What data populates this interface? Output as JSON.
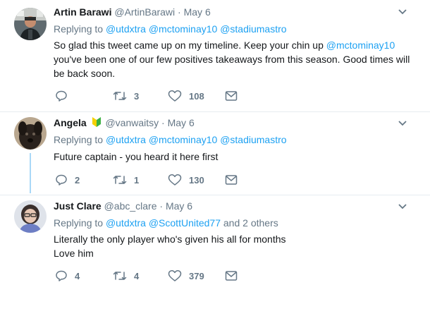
{
  "colors": {
    "link": "#1da1f2",
    "muted": "#657786",
    "text": "#14171a",
    "divider": "#e6ecf0",
    "thread": "#a9d8f7"
  },
  "tweets": [
    {
      "display_name": "Artin Barawi",
      "handle": "@ArtinBarawi",
      "date": "May 6",
      "replying_label": "Replying to",
      "replying_to": [
        "@utdxtra",
        "@mctominay10",
        "@stadiumastro"
      ],
      "text_lines": [
        [
          "So glad this tweet came up on my timeline. Keep your chin up ",
          "@mctominay10"
        ],
        [
          "you've been one of our few positives takeaways from this season. Good times will"
        ],
        [
          "be back soon."
        ]
      ],
      "reply_count": "",
      "retweet_count": "3",
      "like_count": "108",
      "icons": {
        "reply": "reply-icon",
        "retweet": "retweet-icon",
        "like": "heart-icon",
        "dm": "envelope-icon",
        "menu": "chevron-down-icon"
      }
    },
    {
      "display_name": "Angela",
      "badge_icon": "beginner-badge-icon",
      "handle": "@vanwaitsy",
      "date": "May 6",
      "replying_label": "Replying to",
      "replying_to": [
        "@utdxtra",
        "@mctominay10",
        "@stadiumastro"
      ],
      "text_lines": [
        [
          "Future captain - you heard it here first"
        ]
      ],
      "reply_count": "2",
      "retweet_count": "1",
      "like_count": "130"
    },
    {
      "display_name": "Just Clare",
      "handle": "@abc_clare",
      "date": "May 6",
      "replying_label": "Replying to",
      "replying_to": [
        "@utdxtra",
        "@ScottUnited77"
      ],
      "replying_more": "and 2 others",
      "text_lines": [
        [
          "Literally the only player who's given his all for months"
        ],
        [
          "Love him"
        ]
      ],
      "reply_count": "4",
      "retweet_count": "4",
      "like_count": "379"
    }
  ]
}
